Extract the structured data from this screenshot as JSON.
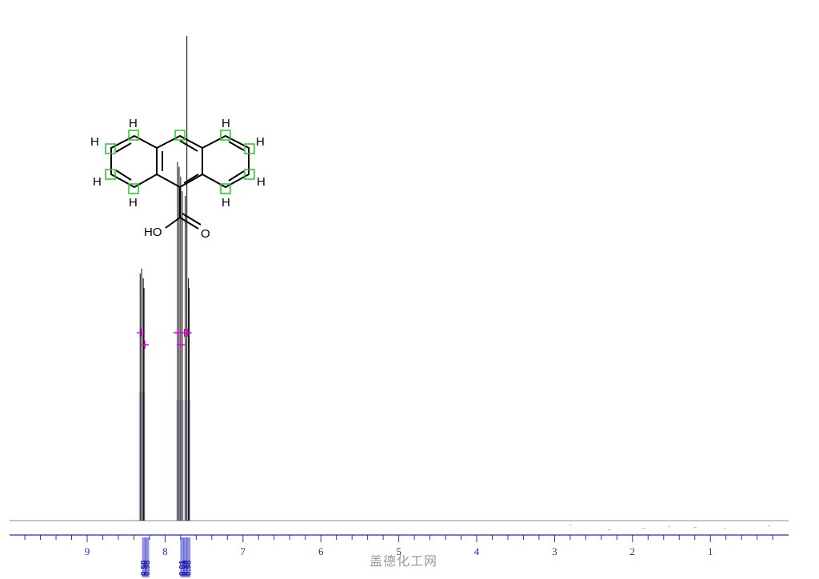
{
  "chart_data": {
    "type": "line",
    "title": "",
    "xlabel": "",
    "ylabel": "",
    "x_reversed": true,
    "xlim": [
      10.0,
      0.0
    ],
    "ylim": [
      0,
      1
    ],
    "x_ticks": [
      9,
      8,
      7,
      6,
      5,
      4,
      3,
      2,
      1
    ],
    "x_tick_labels": [
      "9",
      "8",
      "7",
      "6",
      "5",
      "4",
      "3",
      "2",
      "1"
    ],
    "peaks": [
      {
        "ppm": 8.32,
        "intensity": 0.51
      },
      {
        "ppm": 8.3,
        "intensity": 0.52
      },
      {
        "ppm": 8.28,
        "intensity": 0.5
      },
      {
        "ppm": 8.27,
        "intensity": 0.48
      },
      {
        "ppm": 7.84,
        "intensity": 0.74
      },
      {
        "ppm": 7.82,
        "intensity": 0.73
      },
      {
        "ppm": 7.8,
        "intensity": 0.71
      },
      {
        "ppm": 7.78,
        "intensity": 0.68
      },
      {
        "ppm": 7.74,
        "intensity": 0.67
      },
      {
        "ppm": 7.72,
        "intensity": 1.0
      },
      {
        "ppm": 7.7,
        "intensity": 0.5
      },
      {
        "ppm": 7.69,
        "intensity": 0.48
      }
    ],
    "integrals": [
      {
        "ppm": 8.27,
        "label": "0.50"
      },
      {
        "ppm": 8.23,
        "label": "0.98"
      },
      {
        "ppm": 7.78,
        "label": "0.01"
      },
      {
        "ppm": 7.74,
        "label": "0.98"
      },
      {
        "ppm": 7.7,
        "label": "0.98"
      }
    ]
  },
  "structure": {
    "atoms": {
      "h_labels": [
        "H",
        "H",
        "H",
        "H",
        "H",
        "H",
        "H",
        "H"
      ],
      "hydroxyl": "HO",
      "oxygen": "O"
    },
    "highlight_color": "#22cc22"
  },
  "colors": {
    "axis": "#2b2bb8",
    "spectrum": "#000000",
    "integral_bar": "#3b3bd0",
    "peak_marker": "#e000e0"
  },
  "watermark": "盖德化工网"
}
